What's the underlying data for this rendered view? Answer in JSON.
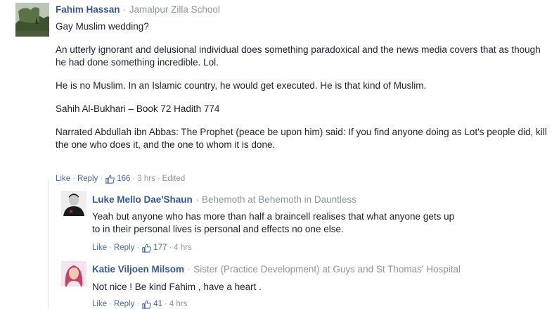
{
  "main_comment": {
    "name": "Fahim Hassan",
    "separator": "·",
    "affiliation": "Jamalpur Zilla School",
    "paragraphs": [
      "Gay Muslim wedding?",
      "An utterly ignorant and delusional individual does something paradoxical and the news media covers that as though he had done something incredible. Lol.",
      "He is no Muslim. In an Islamic country, he would get executed. He is that kind of Muslim.",
      "Sahih Al-Bukhari – Book 72 Hadith 774",
      "Narrated Abdullah ibn Abbas: The Prophet (peace be upon him) said: If you find anyone doing as Lot's people did, kill the one who does it, and the one to whom it is done."
    ],
    "like_label": "Like",
    "reply_label": "Reply",
    "dot": "·",
    "like_count": "166",
    "time": "3 hrs",
    "edited": "Edited"
  },
  "replies": [
    {
      "name": "Luke Mello Dae'Shaun",
      "separator": "·",
      "affiliation": "Behemoth at Behemoth in Dauntless",
      "text": "Yeah but anyone who has more than half a braincell realises that what anyone gets up to in their personal lives is personal and effects no one else.",
      "like_label": "Like",
      "reply_label": "Reply",
      "dot": "·",
      "like_count": "177",
      "time": "4 hrs"
    },
    {
      "name": "Katie Viljoen Milsom",
      "separator": "·",
      "affiliation": "Sister (Practice Development) at Guys and St Thomas' Hospital",
      "text": "Not nice ! Be kind Fahim , have a heart .",
      "like_label": "Like",
      "reply_label": "Reply",
      "dot": "·",
      "like_count": "41",
      "time": "4 hrs"
    }
  ],
  "icons": {
    "like": "thumbs-up-icon"
  },
  "colors": {
    "name": "#365899",
    "link": "#4267b2",
    "meta": "#90949c",
    "text": "#1d2129"
  }
}
